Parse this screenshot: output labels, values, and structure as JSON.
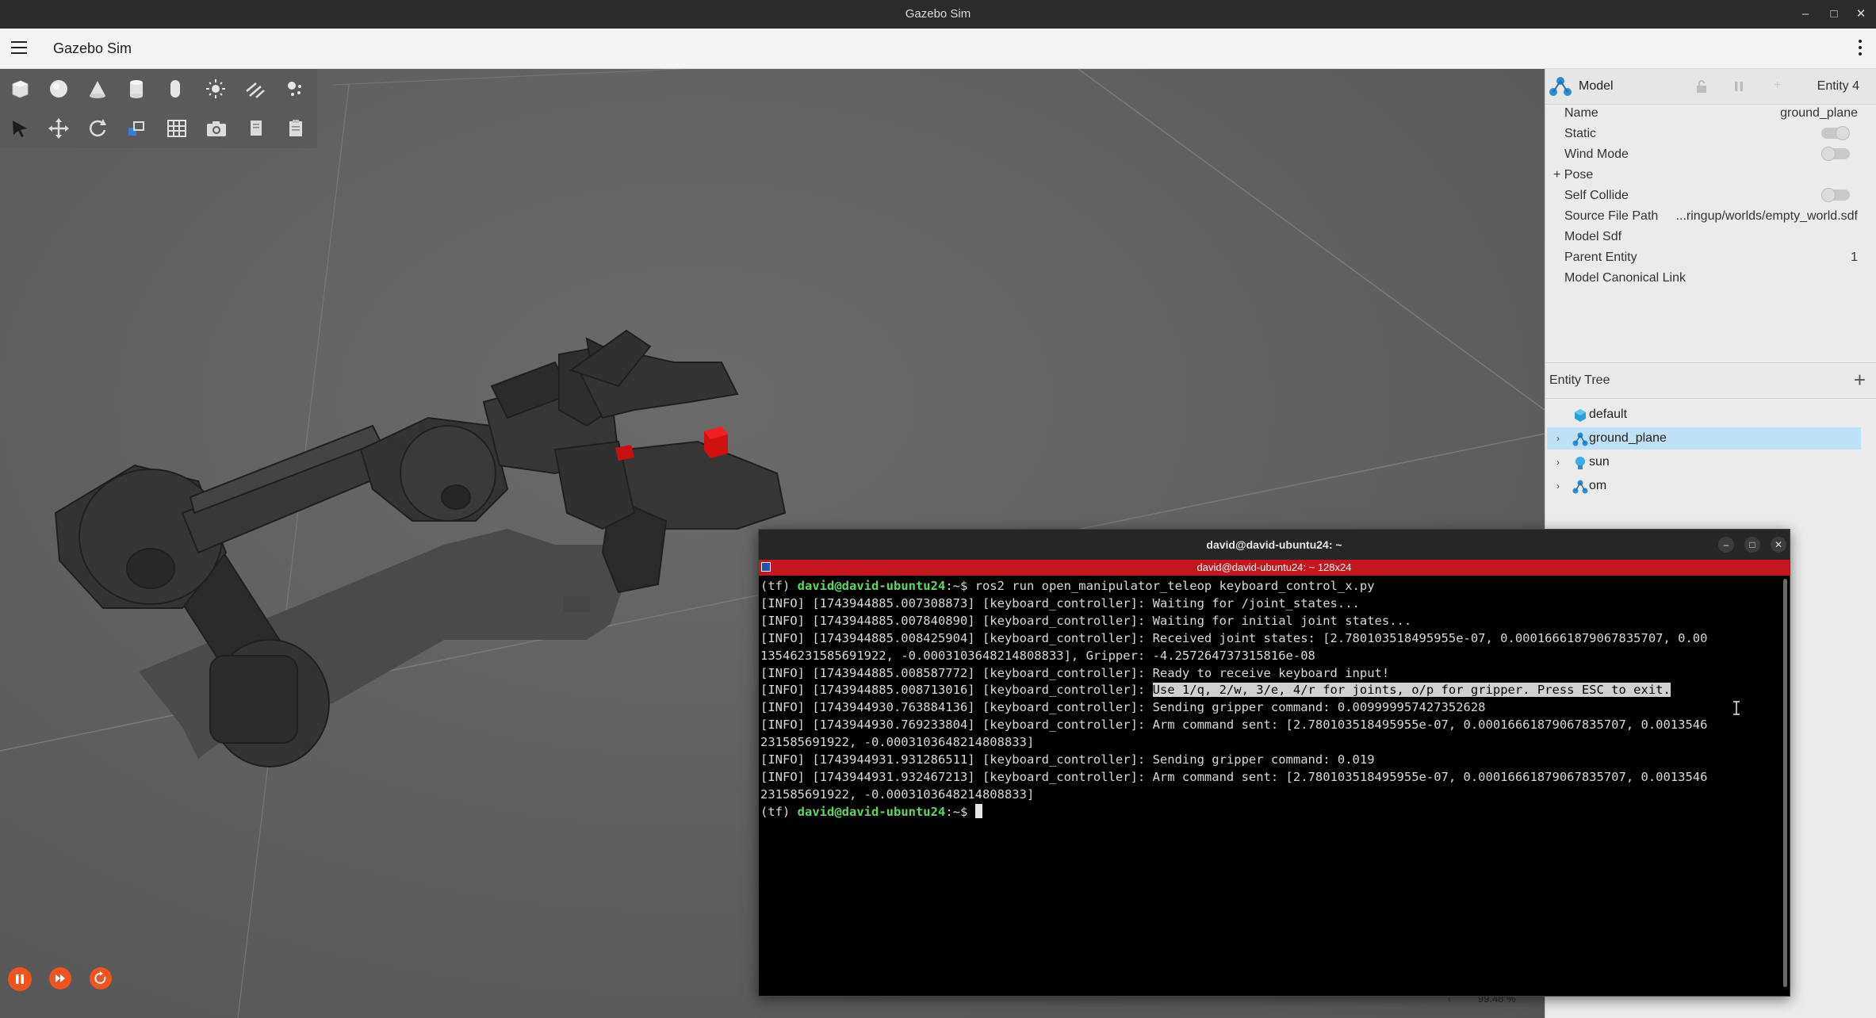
{
  "os": {
    "window_title": "Gazebo Sim",
    "minimize": "–",
    "maximize": "□",
    "close": "✕"
  },
  "app": {
    "title": "Gazebo Sim",
    "menu_icon": "hamburger-icon",
    "more_icon": "kebab-icon"
  },
  "toolbar": {
    "shapes": [
      "box-icon",
      "sphere-icon",
      "cone-icon",
      "cylinder-icon",
      "capsule-icon",
      "sun-light-icon",
      "directional-light-icon",
      "point-light-icon"
    ],
    "tools": [
      "select-icon",
      "translate-icon",
      "rotate-icon",
      "scale-icon",
      "grid-snap-icon",
      "camera-icon",
      "copy-icon",
      "paste-icon"
    ]
  },
  "component_inspector": {
    "model_label": "Model",
    "entity_label": "Entity 4",
    "properties": [
      {
        "label": "Name",
        "value": "ground_plane"
      },
      {
        "label": "Static",
        "toggle": true,
        "on": false
      },
      {
        "label": "Wind Mode",
        "toggle": true,
        "on": false
      },
      {
        "label": "+ Pose",
        "value": ""
      },
      {
        "label": "Self Collide",
        "toggle": true,
        "on": false
      },
      {
        "label": "Source File Path",
        "value": "...ringup/worlds/empty_world.sdf"
      },
      {
        "label": "Model Sdf",
        "value": ""
      },
      {
        "label": "Parent Entity",
        "value": "1"
      },
      {
        "label": "Model Canonical Link",
        "value": ""
      }
    ]
  },
  "entity_tree": {
    "title": "Entity Tree",
    "add_icon": "plus-icon",
    "items": [
      {
        "label": "default",
        "icon": "world-cube-icon",
        "expandable": false,
        "selected": false
      },
      {
        "label": "ground_plane",
        "icon": "model-icon",
        "expandable": true,
        "selected": true
      },
      {
        "label": "sun",
        "icon": "light-bulb-icon",
        "expandable": true,
        "selected": false
      },
      {
        "label": "om",
        "icon": "model-icon",
        "expandable": true,
        "selected": false
      }
    ]
  },
  "terminal": {
    "title": "david@david-ubuntu24: ~",
    "tab_title": "david@david-ubuntu24: ~ 128x24",
    "prompt_env": "(tf) ",
    "prompt_user": "david@david-ubuntu24",
    "prompt_suffix": ":~$ ",
    "command": "ros2 run open_manipulator_teleop keyboard_control_x.py",
    "lines": [
      "[INFO] [1743944885.007308873] [keyboard_controller]: Waiting for /joint_states...",
      "[INFO] [1743944885.007840890] [keyboard_controller]: Waiting for initial joint states...",
      "[INFO] [1743944885.008425904] [keyboard_controller]: Received joint states: [2.780103518495955e-07, 0.00016661879067835707, 0.00",
      "13546231585691922, -0.0003103648214808833], Gripper: -4.257264737315816e-08",
      "[INFO] [1743944885.008587772] [keyboard_controller]: Ready to receive keyboard input!"
    ],
    "highlight_prefix": "[INFO] [1743944885.008713016] [keyboard_controller]: ",
    "highlight_text": "Use 1/q, 2/w, 3/e, 4/r for joints, o/p for gripper. Press ESC to exit.",
    "lines_after": [
      "[INFO] [1743944930.763884136] [keyboard_controller]: Sending gripper command: 0.009999957427352628",
      "[INFO] [1743944930.769233804] [keyboard_controller]: Arm command sent: [2.780103518495955e-07, 0.00016661879067835707, 0.0013546",
      "231585691922, -0.0003103648214808833]",
      "[INFO] [1743944931.931286511] [keyboard_controller]: Sending gripper command: 0.019",
      "[INFO] [1743944931.932467213] [keyboard_controller]: Arm command sent: [2.780103518495955e-07, 0.00016661879067835707, 0.0013546",
      "231585691922, -0.0003103648214808833]"
    ]
  },
  "sim_controls": {
    "pause_icon": "pause-icon",
    "step_icon": "step-forward-icon",
    "reset_icon": "reset-icon",
    "real_time_factor": "99.48 %",
    "accent": "#f0531e"
  }
}
